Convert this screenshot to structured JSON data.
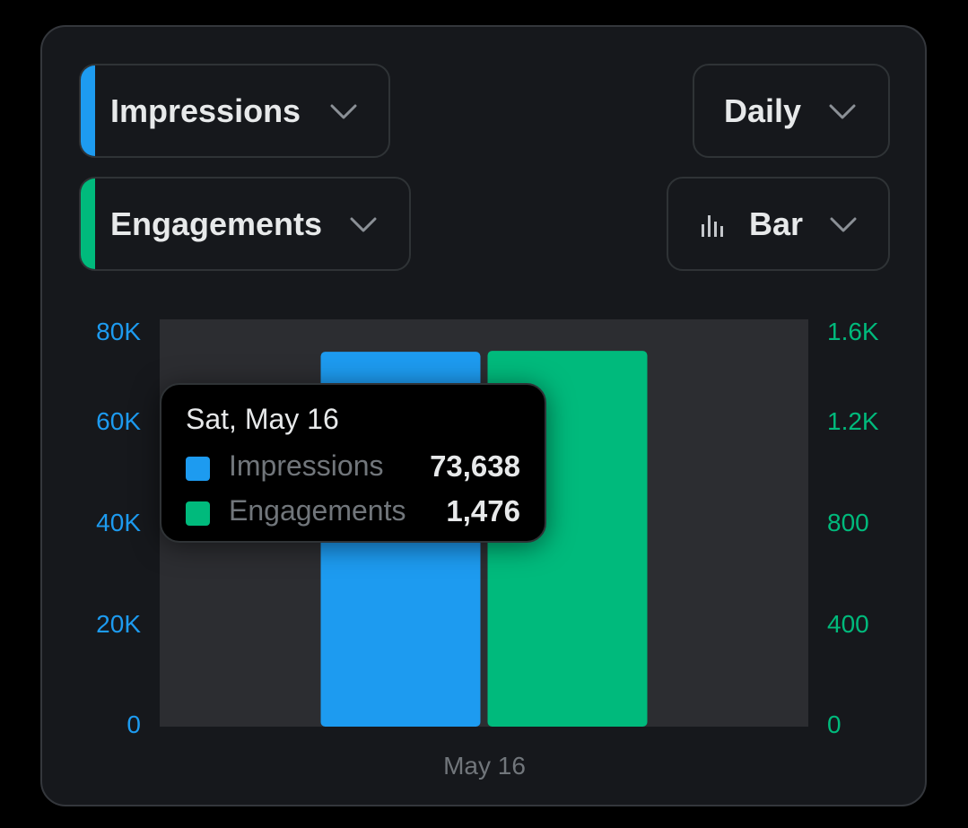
{
  "controls": {
    "metric1": {
      "label": "Impressions",
      "color": "#1d9bf0",
      "icon": "chevron-down-icon"
    },
    "metric2": {
      "label": "Engagements",
      "color": "#00ba7c",
      "icon": "chevron-down-icon"
    },
    "period": {
      "label": "Daily",
      "icon": "chevron-down-icon"
    },
    "chart_type": {
      "label": "Bar",
      "icon": "bar-chart-icon"
    }
  },
  "tooltip": {
    "date": "Sat, May 16",
    "rows": [
      {
        "name": "Impressions",
        "value": "73,638",
        "color": "#1d9bf0"
      },
      {
        "name": "Engagements",
        "value": "1,476",
        "color": "#00ba7c"
      }
    ]
  },
  "chart_data": {
    "type": "bar",
    "categories": [
      "May 16"
    ],
    "series": [
      {
        "name": "Impressions",
        "values": [
          73638
        ],
        "color": "#1d9bf0",
        "axis": "left"
      },
      {
        "name": "Engagements",
        "values": [
          1476
        ],
        "color": "#00ba7c",
        "axis": "right"
      }
    ],
    "y_left": {
      "range": [
        0,
        80000
      ],
      "ticks": [
        "0",
        "20K",
        "40K",
        "60K",
        "80K"
      ],
      "color": "#1d9bf0"
    },
    "y_right": {
      "range": [
        0,
        1600
      ],
      "ticks": [
        "0",
        "400",
        "800",
        "1.2K",
        "1.6K"
      ],
      "color": "#00ba7c"
    },
    "x_tick_labels": [
      "May 16"
    ],
    "grid": false,
    "legend": "none",
    "plot_background": "#2c2d31"
  }
}
